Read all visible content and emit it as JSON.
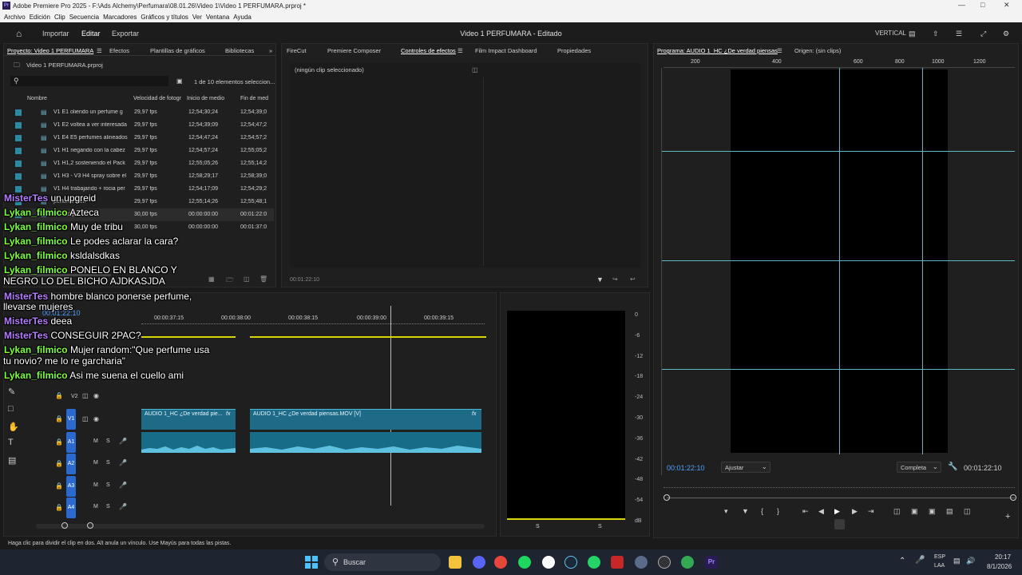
{
  "window": {
    "title": "Adobe Premiere Pro 2025 - F:\\Ads Alchemy\\Perfumara\\08.01.26\\Video 1\\Video 1 PERFUMARA.prproj *"
  },
  "menu": [
    "Archivo",
    "Edición",
    "Clip",
    "Secuencia",
    "Marcadores",
    "Gráficos y títulos",
    "Ver",
    "Ventana",
    "Ayuda"
  ],
  "workspace": {
    "importar": "Importar",
    "editar": "Editar",
    "exportar": "Exportar",
    "doc_title": "Video 1 PERFUMARA - Editado",
    "layout": "VERTICAL"
  },
  "project_panel": {
    "tabs": [
      "Proyecto: Video 1 PERFUMARA",
      "Efectos",
      "Plantillas de gráficos",
      "Bibliotecas"
    ],
    "file": "Video 1 PERFUMARA.prproj",
    "count": "1 de 10 elementos seleccion...",
    "headers": [
      "Nombre",
      "Velocidad de fotogr",
      "Inicio de medio",
      "Fin de med"
    ],
    "rows": [
      [
        "V1 E1 oliendo un perfume g",
        "29,97 fps",
        "12;54;30;24",
        "12;54;39;0"
      ],
      [
        "V1 E2 voltea a ver interesada",
        "29,97 fps",
        "12;54;39;09",
        "12;54;47;2"
      ],
      [
        "V1 E4 E5 perfumes alineados",
        "29,97 fps",
        "12;54;47;24",
        "12;54;57;2"
      ],
      [
        "V1 H1 negando con la cabez",
        "29,97 fps",
        "12;54;57;24",
        "12;55;05;2"
      ],
      [
        "V1 H1,2 sosteniendo el Pack",
        "29,97 fps",
        "12;55;05;26",
        "12;55;14;2"
      ],
      [
        "V1 H3 - V3 H4 spray sobre el",
        "29,97 fps",
        "12;58;29;17",
        "12;58;39;0"
      ],
      [
        "V1 H4 trabajando + rocia per",
        "29,97 fps",
        "12;54;17;09",
        "12;54;29;2"
      ],
      [
        "perfume sien",
        "29,97 fps",
        "12;55;14;26",
        "12;55;48;1"
      ],
      [
        "verdad pie",
        "30,00 fps",
        "00:00:00:00",
        "00:01:22:0"
      ],
      [
        "",
        "30,00 fps",
        "00:00:00:00",
        "00:01:37:0"
      ]
    ]
  },
  "effects_panel": {
    "tabs": [
      "FireCut",
      "Premiere Composer",
      "Controles de efectos",
      "Film Impact Dashboard",
      "Propiedades"
    ],
    "empty": "(ningún clip seleccionado)",
    "timecode": "00:01:22:10"
  },
  "program": {
    "tab": "Programa: AUDIO 1_HC ¿De verdad piensas",
    "origin": "Origen: (sin clips)",
    "timecode": "00:01:22:10",
    "fit": "Ajustar",
    "quality": "Completa",
    "duration": "00:01:22:10",
    "ruler": [
      "200",
      "200",
      "400",
      "600",
      "800",
      "1000",
      "1200"
    ]
  },
  "timeline": {
    "timecode": "00:01:22:10",
    "ruler": [
      "00:00:37:15",
      "00:00:38:00",
      "00:00:38:15",
      "00:00:39:00",
      "00:00:39:15"
    ],
    "tracks": [
      "V2",
      "V1",
      "A1",
      "A2",
      "A3",
      "A4"
    ],
    "clips": [
      "AUDIO 1_HC ¿De verdad pie...",
      "AUDIO 1_HC ¿De verdad piensas.MOV [V]"
    ]
  },
  "meter": {
    "scale": [
      "0",
      "-6",
      "-12",
      "-18",
      "-24",
      "-30",
      "-36",
      "-42",
      "-48",
      "-54",
      "dB"
    ],
    "s1": "S",
    "s2": "S"
  },
  "chat": [
    {
      "user": "MisterTes",
      "msg": "un upgreid",
      "color": "#b47cff"
    },
    {
      "user": "Lykan_filmico",
      "msg": "Azteca",
      "color": "#7cff3a"
    },
    {
      "user": "Lykan_filmico",
      "msg": "Muy de tribu",
      "color": "#7cff3a"
    },
    {
      "user": "Lykan_filmico",
      "msg": "Le podes aclarar la cara?",
      "color": "#7cff3a"
    },
    {
      "user": "Lykan_filmico",
      "msg": "ksldalsdkas",
      "color": "#7cff3a"
    },
    {
      "user": "Lykan_filmico",
      "msg": "PONELO EN BLANCO Y",
      "color": "#7cff3a"
    },
    {
      "user": "",
      "msg": "NEGRO LO DEL BICHO AJDKASJDA",
      "color": ""
    },
    {
      "user": "MisterTes",
      "msg": "hombre blanco ponerse perfume,",
      "color": "#b47cff"
    },
    {
      "user": "",
      "msg": "llevarse mujeres",
      "color": ""
    },
    {
      "user": "MisterTes",
      "msg": "deea",
      "color": "#b47cff"
    },
    {
      "user": "MisterTes",
      "msg": "CONSEGUIR 2PAC?",
      "color": "#b47cff"
    },
    {
      "user": "Lykan_filmico",
      "msg": "Mujer random:\"Que perfume usa",
      "color": "#7cff3a"
    },
    {
      "user": "",
      "msg": "tu novio? me lo re garcharia\"",
      "color": ""
    },
    {
      "user": "Lykan_filmico",
      "msg": "Asi me suena el cuello ami",
      "color": "#7cff3a"
    }
  ],
  "status": "Haga clic para dividir el clip en dos. Alt anula un vínculo. Use Mayús para todas las pistas.",
  "taskbar": {
    "search": "Buscar",
    "lang1": "ESP",
    "lang2": "LAA",
    "time": "20:17",
    "date": "8/1/2026"
  }
}
